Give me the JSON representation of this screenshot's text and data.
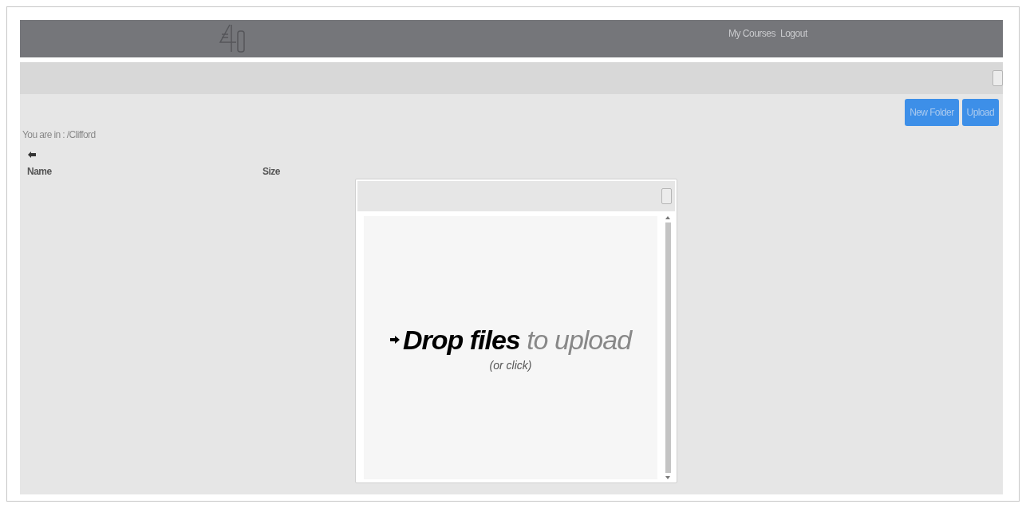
{
  "header": {
    "nav_links": [
      "My Courses",
      "Logout"
    ]
  },
  "toolbar": {
    "buttons": [
      "New Folder",
      "Upload"
    ]
  },
  "breadcrumb": "You are in : /Clifford",
  "file_table": {
    "columns": [
      "Name",
      "Size"
    ]
  },
  "upload_dialog": {
    "drop_text": "**Drop files** to upload",
    "hint": "(or click)"
  }
}
